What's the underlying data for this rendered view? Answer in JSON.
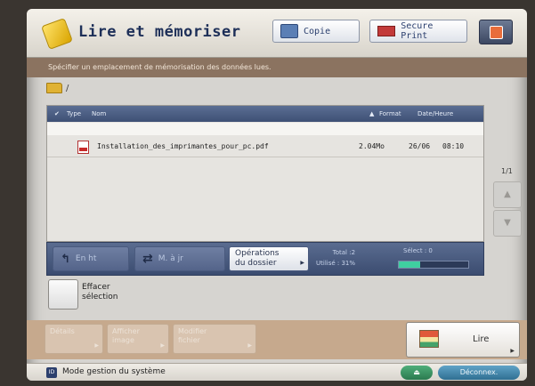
{
  "header": {
    "title": "Lire et mémoriser",
    "copy_label": "Copie",
    "secure_print_label": "Secure Print"
  },
  "instruction": "Spécifier un emplacement de mémorisation des données lues.",
  "path": "/",
  "file_list": {
    "columns": {
      "check": "✔",
      "type": "Type",
      "name": "Nom",
      "sort_indicator": "▲",
      "format": "Format",
      "date": "Date/Heure"
    },
    "rows": [
      {
        "type_icon": "pdf-icon",
        "name": "Installation_des_imprimantes_pour_pc.pdf",
        "format": "2.04Mo",
        "date": "26/06",
        "time": "08:10"
      }
    ],
    "page": "1/1"
  },
  "toolbar": {
    "up_label": "En ht",
    "refresh_label": "M. à jr",
    "folder_ops_line1": "Opérations",
    "folder_ops_line2": "du dossier",
    "total_label": "Total :2",
    "used_label": "Utilisé : 31%",
    "selected_label": "Sélect : 0",
    "usage_fraction": 0.31
  },
  "clear_selection": {
    "line1": "Effacer",
    "line2": "sélection"
  },
  "actions": {
    "details": "Détails",
    "show_image_line1": "Afficher",
    "show_image_line2": "image",
    "modify_file_line1": "Modifier",
    "modify_file_line2": "fichier",
    "read": "Lire"
  },
  "status": {
    "id_badge": "ID",
    "mode_text": "Mode gestion du système",
    "logout": "Déconnex."
  },
  "icons": {
    "up": "arrow-up-icon",
    "refresh": "refresh-icon",
    "eject": "eject-icon"
  },
  "colors": {
    "header_blue": "#3e5075",
    "instruction_bar": "#8b7360",
    "usage_bar": "#3fcfa0",
    "logout_button": "#2f6f92"
  }
}
